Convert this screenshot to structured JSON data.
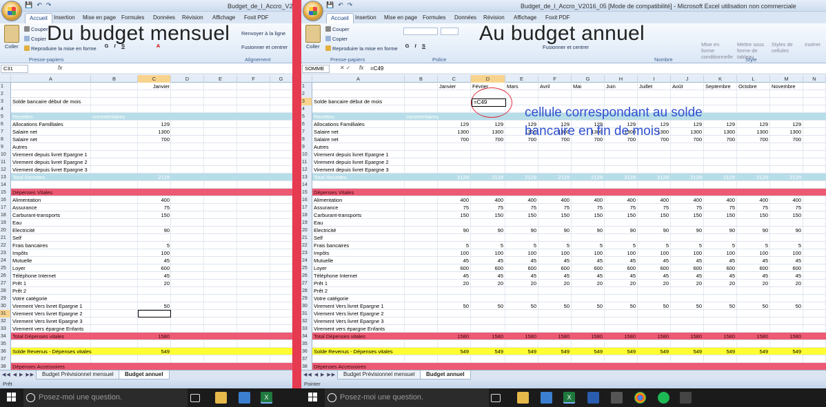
{
  "left": {
    "window_title": "Budget_de_l_Accro_V2",
    "overlay_title": "Du budget mensuel",
    "name_box": "C31",
    "formula": "",
    "status": "Prêt",
    "tabs": [
      "Accueil",
      "Insertion",
      "Mise en page",
      "Formules",
      "Données",
      "Révision",
      "Affichage",
      "Foxit PDF"
    ],
    "columns": [
      "A",
      "B",
      "C",
      "D",
      "E",
      "F",
      "G"
    ],
    "sheet_tabs": [
      "Budget Prévisionnel mensuel",
      "Budget annuel"
    ],
    "ribbon": {
      "paste": "Coller",
      "cut": "Couper",
      "copy": "Copier",
      "format_painter": "Reproduire la mise en forme",
      "group_clipboard": "Presse-papiers",
      "group_align": "Alignement",
      "wrap": "Renvoyer à la ligne",
      "merge": "Fusionner et centrer"
    }
  },
  "right": {
    "window_title": "Budget_de_l_Accro_V2016_05 [Mode de compatibilité] - Microsoft Excel utilisation non commerciale",
    "overlay_title": "Au budget annuel",
    "name_box": "SOMME",
    "formula": "=C49",
    "status": "Pointer",
    "tabs": [
      "Accueil",
      "Insertion",
      "Mise en page",
      "Formules",
      "Données",
      "Révision",
      "Affichage",
      "Foxit PDF"
    ],
    "columns": [
      "A",
      "B",
      "C",
      "D",
      "E",
      "F",
      "G",
      "H",
      "I",
      "J",
      "K",
      "L",
      "M",
      "N"
    ],
    "months": [
      "Janvier",
      "Février",
      "Mars",
      "Avril",
      "Mai",
      "Juin",
      "Juillet",
      "Août",
      "Septembre",
      "Octobre",
      "Novembre"
    ],
    "sheet_tabs": [
      "Budget Prévisionnel mensuel",
      "Budget annuel"
    ],
    "ribbon": {
      "paste": "Coller",
      "cut": "Couper",
      "copy": "Copier",
      "format_painter": "Reproduire la mise en forme",
      "group_clipboard": "Presse-papiers",
      "group_police": "Police",
      "group_number": "Nombre",
      "group_style": "Style",
      "merge": "Fusionner et centrer",
      "mise_en_forme": "Mise en forme conditionnelle",
      "mettre_sous_forme": "Mettre sous forme de tableau",
      "styles": "Styles de cellules",
      "insert": "Insérer"
    },
    "annotation": {
      "cell_text": "=C49",
      "note": "cellule correspondant au solde bancaire en fin de mois"
    }
  },
  "rows": [
    {
      "n": "1",
      "label": "",
      "style": "",
      "c": "Janvier",
      "val": ""
    },
    {
      "n": "2",
      "label": "",
      "style": "",
      "c": "",
      "val": ""
    },
    {
      "n": "3",
      "label": "Solde bancaire début de mois",
      "style": "",
      "c": "",
      "val": ""
    },
    {
      "n": "4",
      "label": "",
      "style": "",
      "c": "",
      "val": ""
    },
    {
      "n": "5",
      "label": "Recettes",
      "b": "commentaires",
      "style": "blue",
      "c": "",
      "val": ""
    },
    {
      "n": "6",
      "label": "Allocations Familliales",
      "style": "",
      "c": "129",
      "val": "129"
    },
    {
      "n": "7",
      "label": "Salaire net",
      "style": "",
      "c": "1300",
      "val": "1300"
    },
    {
      "n": "8",
      "label": "Salaire net",
      "style": "",
      "c": "700",
      "val": "700"
    },
    {
      "n": "9",
      "label": "Autres",
      "style": "",
      "c": "",
      "val": ""
    },
    {
      "n": "10",
      "label": "Virement depuis livret Epargne 1",
      "style": "",
      "c": "",
      "val": ""
    },
    {
      "n": "11",
      "label": "Virement depuis livret Epargne 2",
      "style": "",
      "c": "",
      "val": ""
    },
    {
      "n": "12",
      "label": "Virement depuis livret Epargne 3",
      "style": "",
      "c": "",
      "val": ""
    },
    {
      "n": "13",
      "label": "Total Recettes",
      "style": "blue",
      "c": "2129",
      "val": "2129"
    },
    {
      "n": "14",
      "label": "",
      "style": "",
      "c": "",
      "val": ""
    },
    {
      "n": "15",
      "label": "Dépenses Vitales",
      "style": "red",
      "c": "",
      "val": ""
    },
    {
      "n": "16",
      "label": "Alimentation",
      "style": "",
      "c": "400",
      "val": "400"
    },
    {
      "n": "17",
      "label": "Assurance",
      "style": "",
      "c": "75",
      "val": "75"
    },
    {
      "n": "18",
      "label": "Carburant-transports",
      "style": "",
      "c": "150",
      "val": "150"
    },
    {
      "n": "19",
      "label": "Eau",
      "style": "",
      "c": "",
      "val": ""
    },
    {
      "n": "20",
      "label": "Electricité",
      "style": "",
      "c": "90",
      "val": "90"
    },
    {
      "n": "21",
      "label": "Self",
      "style": "",
      "c": "",
      "val": ""
    },
    {
      "n": "22",
      "label": "Frais bancaires",
      "style": "",
      "c": "5",
      "val": "5"
    },
    {
      "n": "23",
      "label": "Impôts",
      "style": "",
      "c": "100",
      "val": "100"
    },
    {
      "n": "24",
      "label": "Mutuelle",
      "style": "",
      "c": "45",
      "val": "45"
    },
    {
      "n": "25",
      "label": "Loyer",
      "style": "",
      "c": "600",
      "val": "600"
    },
    {
      "n": "26",
      "label": "Téléphone Internet",
      "style": "",
      "c": "45",
      "val": "45"
    },
    {
      "n": "27",
      "label": "Prêt 1",
      "style": "",
      "c": "20",
      "val": "20"
    },
    {
      "n": "28",
      "label": "Prêt 2",
      "style": "",
      "c": "",
      "val": ""
    },
    {
      "n": "29",
      "label": "Votre catégorie",
      "style": "",
      "c": "",
      "val": ""
    },
    {
      "n": "30",
      "label": "Virement Vers livret Epargne 1",
      "style": "",
      "c": "50",
      "val": "50"
    },
    {
      "n": "31",
      "label": "Virement Vers livret Epargne 2",
      "style": "",
      "c": "",
      "val": ""
    },
    {
      "n": "32",
      "label": "Virement Vers livret Epargne 3",
      "style": "",
      "c": "",
      "val": ""
    },
    {
      "n": "33",
      "label": "Virement vers épargne Enfants",
      "style": "",
      "c": "",
      "val": ""
    },
    {
      "n": "34",
      "label": "Total Dépenses vitales",
      "style": "red",
      "c": "1580",
      "val": "1580"
    },
    {
      "n": "35",
      "label": "",
      "style": "",
      "c": "",
      "val": ""
    },
    {
      "n": "36",
      "label": "Solde Revenus - Dépenses vitales",
      "style": "yellow",
      "c": "549",
      "val": "549"
    },
    {
      "n": "37",
      "label": "",
      "style": "",
      "c": "",
      "val": ""
    },
    {
      "n": "38",
      "label": "Dépenses Accessoires",
      "style": "red",
      "c": "",
      "val": ""
    }
  ],
  "taskbar": {
    "search_placeholder": "Posez-moi une question."
  }
}
